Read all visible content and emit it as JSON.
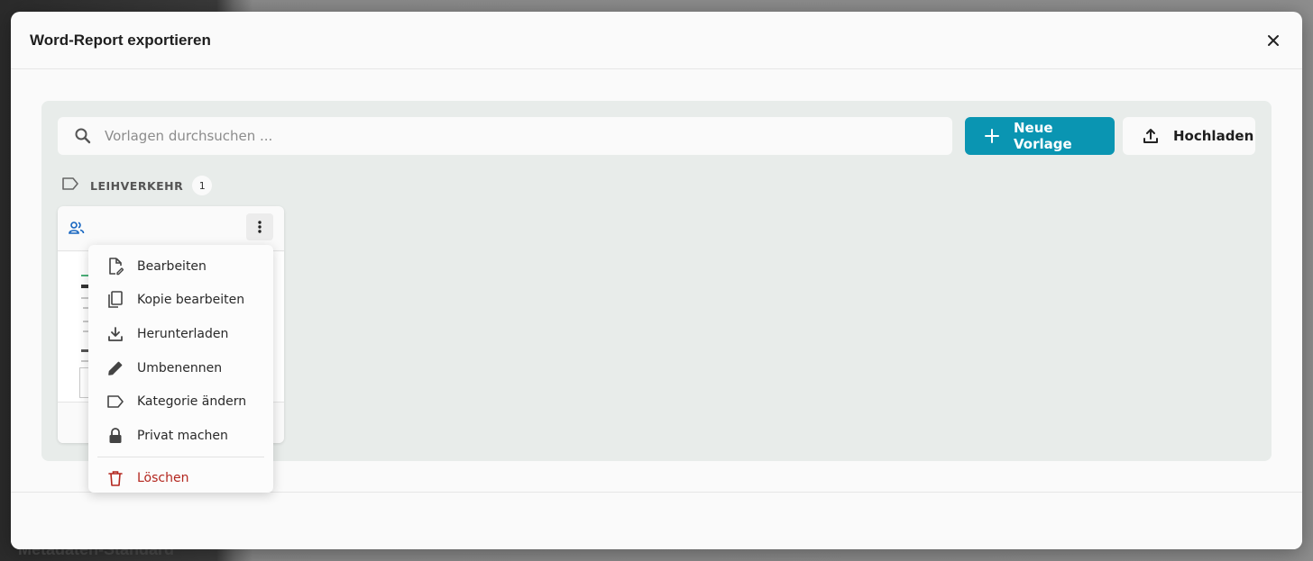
{
  "modal": {
    "title": "Word-Report exportieren"
  },
  "search": {
    "placeholder": "Vorlagen durchsuchen ..."
  },
  "buttons": {
    "new_template": "Neue Vorlage",
    "upload": "Hochladen"
  },
  "category": {
    "name": "LEIHVERKEHR",
    "count": "1"
  },
  "menu": {
    "items": [
      {
        "label": "Bearbeiten",
        "icon": "edit-document-icon"
      },
      {
        "label": "Kopie bearbeiten",
        "icon": "copy-icon"
      },
      {
        "label": "Herunterladen",
        "icon": "download-icon"
      },
      {
        "label": "Umbenennen",
        "icon": "pencil-icon"
      },
      {
        "label": "Kategorie ändern",
        "icon": "label-icon"
      },
      {
        "label": "Privat machen",
        "icon": "lock-icon"
      },
      {
        "label": "Löschen",
        "icon": "trash-icon"
      }
    ]
  },
  "background": {
    "text": "Metadaten-Standard"
  },
  "colors": {
    "accent": "#0a95b2",
    "danger": "#b3261e",
    "panel": "#e8ecea",
    "shared_icon": "#1565c0"
  }
}
